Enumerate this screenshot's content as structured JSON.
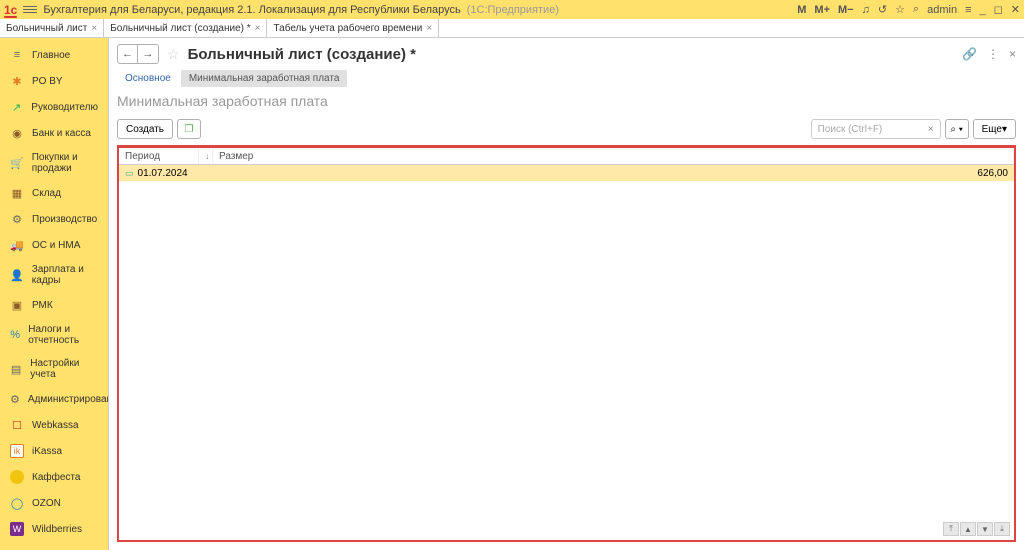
{
  "titlebar": {
    "logo": "1c",
    "main": "Бухгалтерия для Беларуси, редакция 2.1. Локализация для Республики Беларусь",
    "sub": "(1С:Предприятие)",
    "m": "M",
    "m_plus": "M+",
    "m_minus": "M−",
    "user": "admin"
  },
  "tabs": [
    {
      "label": "Больничный лист"
    },
    {
      "label": "Больничный лист (создание) *"
    },
    {
      "label": "Табель учета рабочего времени"
    }
  ],
  "sidebar": [
    {
      "label": "Главное",
      "icon": "≡",
      "cls": "icon-gray"
    },
    {
      "label": "PO BY",
      "icon": "✱",
      "cls": "icon-orange"
    },
    {
      "label": "Руководителю",
      "icon": "↗",
      "cls": "icon-green"
    },
    {
      "label": "Банк и касса",
      "icon": "◉",
      "cls": "icon-brown"
    },
    {
      "label": "Покупки и продажи",
      "icon": "🛒",
      "cls": "icon-brown"
    },
    {
      "label": "Склад",
      "icon": "▦",
      "cls": "icon-brown"
    },
    {
      "label": "Производство",
      "icon": "⚙",
      "cls": "icon-gray"
    },
    {
      "label": "ОС и НМА",
      "icon": "🚚",
      "cls": "icon-brown"
    },
    {
      "label": "Зарплата и кадры",
      "icon": "👤",
      "cls": "icon-gray"
    },
    {
      "label": "РМК",
      "icon": "▣",
      "cls": "icon-brown"
    },
    {
      "label": "Налоги и отчетность",
      "icon": "%",
      "cls": "icon-blue"
    },
    {
      "label": "Настройки учета",
      "icon": "▤",
      "cls": "icon-gray"
    },
    {
      "label": "Администрирование",
      "icon": "⚙",
      "cls": "icon-gray"
    },
    {
      "label": "Webkassa",
      "icon": "☐",
      "cls": "icon-red",
      "badge": null
    },
    {
      "label": "iKassa",
      "icon": "ik",
      "cls": "",
      "badge": "ik"
    },
    {
      "label": "Каффеста",
      "icon": "",
      "cls": "",
      "badge": "cf"
    },
    {
      "label": "OZON",
      "icon": "◯",
      "cls": "icon-blue"
    },
    {
      "label": "Wildberries",
      "icon": "W",
      "cls": "",
      "badge": "wb"
    }
  ],
  "page": {
    "title": "Больничный лист (создание) *",
    "subtabs": [
      {
        "label": "Основное",
        "link": true
      },
      {
        "label": "Минимальная заработная плата",
        "active": true
      }
    ],
    "section": "Минимальная заработная плата",
    "create_btn": "Создать",
    "search_placeholder": "Поиск (Ctrl+F)",
    "more_btn": "Еще",
    "table": {
      "col_period": "Период",
      "col_size": "Размер",
      "rows": [
        {
          "date": "01.07.2024",
          "value": "626,00"
        }
      ]
    }
  }
}
